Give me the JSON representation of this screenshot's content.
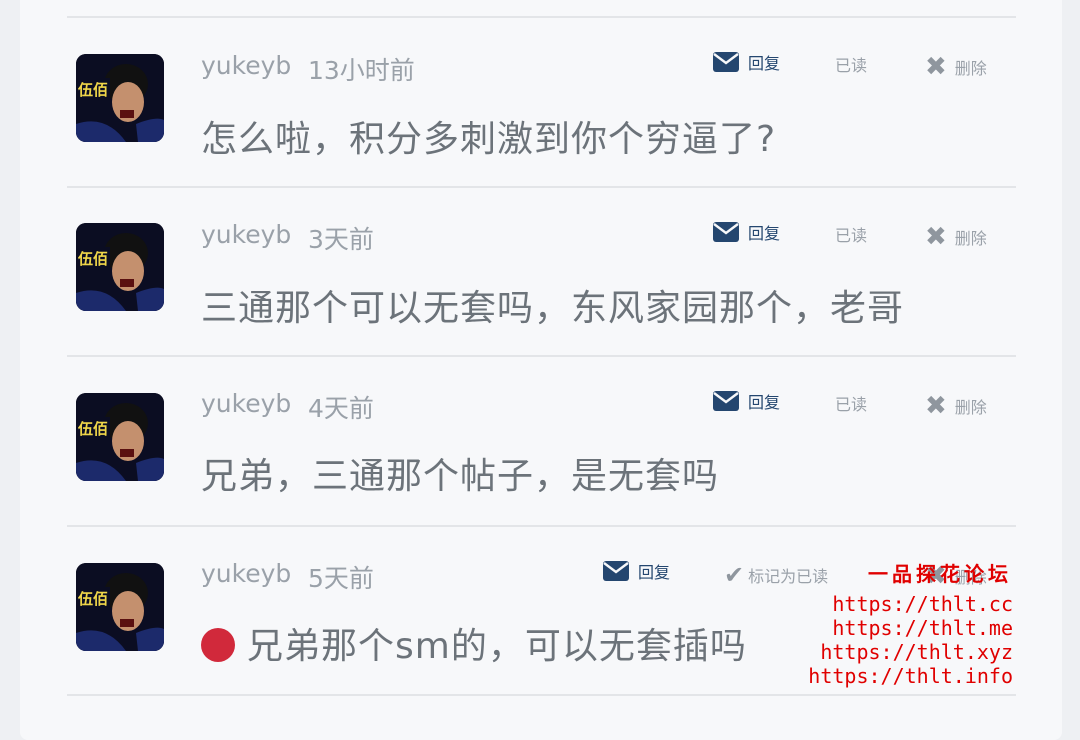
{
  "messages": [
    {
      "user": "yukeyb",
      "time": "13小时前",
      "reply_label": "回复",
      "status_label": "已读",
      "delete_label": "删除",
      "content": "怎么啦，积分多刺激到你个穷逼了?",
      "unread": false
    },
    {
      "user": "yukeyb",
      "time": "3天前",
      "reply_label": "回复",
      "status_label": "已读",
      "delete_label": "删除",
      "content": "三通那个可以无套吗，东风家园那个，老哥",
      "unread": false
    },
    {
      "user": "yukeyb",
      "time": "4天前",
      "reply_label": "回复",
      "status_label": "已读",
      "delete_label": "删除",
      "content": "兄弟，三通那个帖子，是无套吗",
      "unread": false
    },
    {
      "user": "yukeyb",
      "time": "5天前",
      "reply_label": "回复",
      "status_label": "标记为已读",
      "delete_label": "删除",
      "content": "兄弟那个sm的，可以无套插吗",
      "unread": true
    }
  ],
  "avatar_text": "伍佰",
  "watermark": {
    "title": "一品探花论坛",
    "links": [
      "https://thlt.cc",
      "https://thlt.me",
      "https://thlt.xyz",
      "https://thlt.info"
    ]
  },
  "colors": {
    "reply": "#24466f",
    "unread_dot": "#d1293b",
    "watermark": "#e00000"
  }
}
